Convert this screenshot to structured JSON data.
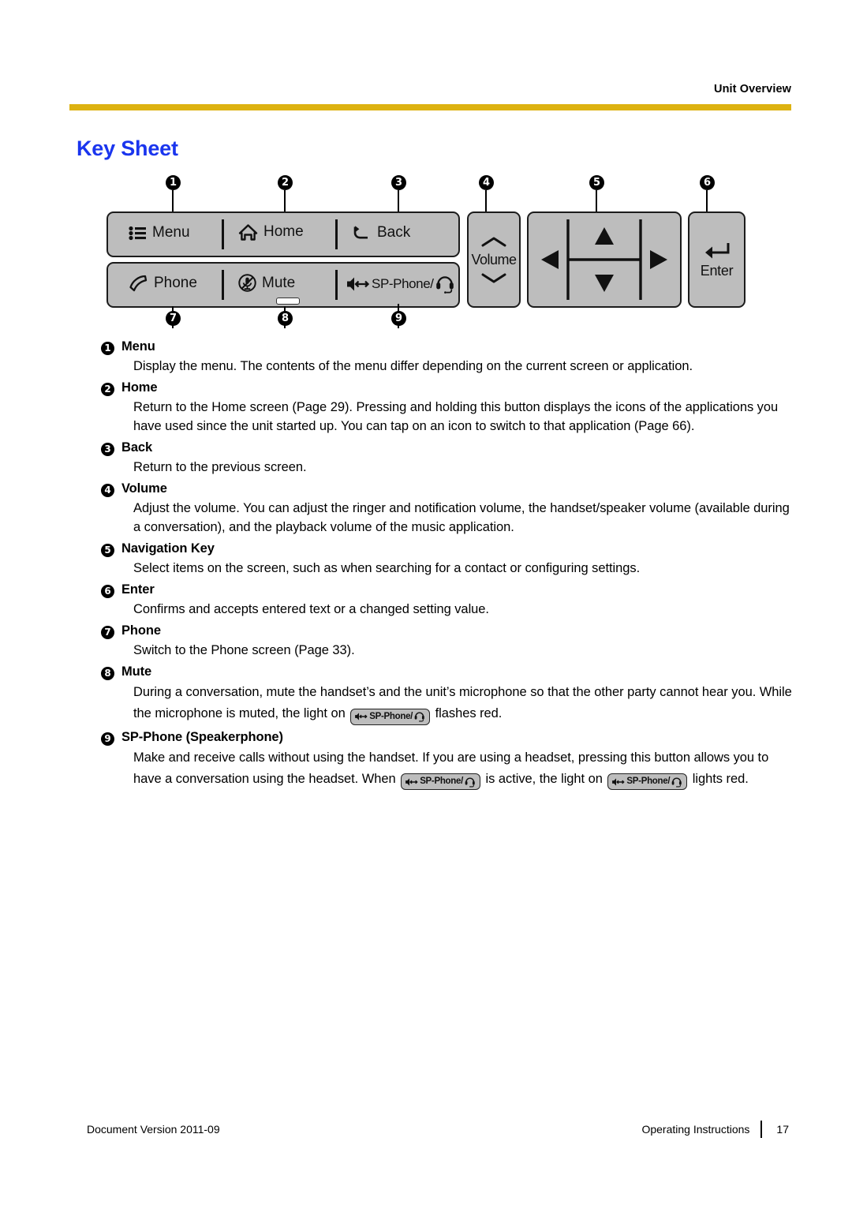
{
  "header": {
    "title": "Unit Overview",
    "rule_color": "#ddb211"
  },
  "section": {
    "title": "Key Sheet",
    "title_color": "#1a35ee"
  },
  "key_diagram": {
    "plate_color": "#bdbdbd",
    "callouts": [
      "1",
      "2",
      "3",
      "4",
      "5",
      "6",
      "7",
      "8",
      "9"
    ],
    "keys": [
      {
        "id": "menu",
        "label": "Menu",
        "icon": "list-icon",
        "callout": "1"
      },
      {
        "id": "home",
        "label": "Home",
        "icon": "home-icon",
        "callout": "2"
      },
      {
        "id": "back",
        "label": "Back",
        "icon": "back-arrow-icon",
        "callout": "3"
      },
      {
        "id": "phone",
        "label": "Phone",
        "icon": "handset-icon",
        "callout": "7"
      },
      {
        "id": "mute",
        "label": "Mute",
        "icon": "mic-muted-icon",
        "callout": "8"
      },
      {
        "id": "spphone",
        "label": "SP-Phone/",
        "icon": "speaker-headset-icon",
        "callout": "9"
      },
      {
        "id": "volume",
        "label": "Volume",
        "icon": "chevron-up-down-icon",
        "callout": "4"
      },
      {
        "id": "navigation",
        "label": "",
        "icon": "dpad-icon",
        "callout": "5"
      },
      {
        "id": "enter",
        "label": "Enter",
        "icon": "enter-arrow-icon",
        "callout": "6"
      }
    ]
  },
  "items": [
    {
      "num": "1",
      "title": "Menu",
      "body": "Display the menu. The contents of the menu differ depending on the current screen or application."
    },
    {
      "num": "2",
      "title": "Home",
      "body": "Return to the Home screen (Page 29). Pressing and holding this button displays the icons of the applications you have used since the unit started up. You can tap on an icon to switch to that application (Page 66)."
    },
    {
      "num": "3",
      "title": "Back",
      "body": "Return to the previous screen."
    },
    {
      "num": "4",
      "title": "Volume",
      "body": "Adjust the volume. You can adjust the ringer and notification volume, the handset/speaker volume (available during a conversation), and the playback volume of the music application."
    },
    {
      "num": "5",
      "title": "Navigation Key",
      "body": "Select items on the screen, such as when searching for a contact or configuring settings."
    },
    {
      "num": "6",
      "title": "Enter",
      "body": "Confirms and accepts entered text or a changed setting value."
    },
    {
      "num": "7",
      "title": "Phone",
      "body": "Switch to the Phone screen (Page 33)."
    },
    {
      "num": "8",
      "title": "Mute",
      "body_part1": "During a conversation, mute the handset’s and the unit’s microphone so that the other party cannot hear you. While the microphone is muted, the light on ",
      "body_part2": " flashes red."
    },
    {
      "num": "9",
      "title": "SP-Phone (Speakerphone)",
      "body_part1": "Make and receive calls without using the handset. If you are using a headset, pressing this button allows you to have a conversation using the headset. When ",
      "body_part2": " is active, the light on ",
      "body_part3": " lights red."
    }
  ],
  "chip_label": "SP-Phone/",
  "footer": {
    "document_version": "Document Version  2011-09",
    "doc_name": "Operating Instructions",
    "page_number": "17"
  }
}
